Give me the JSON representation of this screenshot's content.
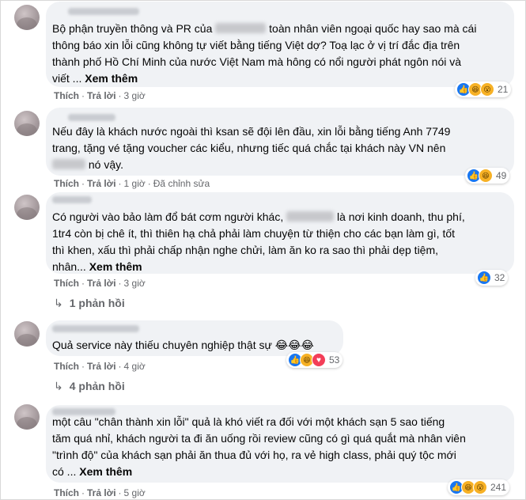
{
  "comments": [
    {
      "lines": [
        [
          "Bộ phận truyền thông và PR của ",
          " toàn nhân viên ngoại quốc hay sao mà cái"
        ],
        [
          "thông báo xin lỗi cũng không tự viết bằng tiếng Việt dợ? Toạ lạc ở vị trí đắc địa trên"
        ],
        [
          "thành phố Hồ Chí Minh của nước Việt Nam mà hông có nổi người phát ngôn nói và"
        ],
        [
          "viết ... "
        ]
      ],
      "see_more": "Xem thêm",
      "like": "Thích",
      "reply": "Trả lời",
      "time": "3 giờ",
      "reaction_count": "21"
    },
    {
      "lines": [
        [
          "Nếu đây là khách nước ngoài thì ksan sẽ đội lên đầu, xin lỗi bằng tiếng Anh 7749"
        ],
        [
          "trang, tặng vé tặng voucher các kiểu, nhưng tiếc quá chắc tại khách này VN nên"
        ],
        [
          "",
          " nó vậy."
        ]
      ],
      "like": "Thích",
      "reply": "Trả lời",
      "time": "1 giờ",
      "edited": "Đã chỉnh sửa",
      "reaction_count": "49"
    },
    {
      "lines": [
        [
          "Có người vào bảo làm đổ bát cơm người khác, ",
          " là nơi kinh doanh, thu phí,"
        ],
        [
          "1tr4 còn bị chê ít, thì thiên hạ chả phải làm chuyện từ thiện cho các bạn làm gì, tốt"
        ],
        [
          "thì khen, xấu thì phải chấp nhận nghe chửi, làm ăn ko ra sao thì phải dẹp tiệm,"
        ],
        [
          "nhân... "
        ]
      ],
      "see_more": "Xem thêm",
      "like": "Thích",
      "reply": "Trả lời",
      "time": "3 giờ",
      "reaction_count": "32",
      "replies": "1 phản hồi"
    },
    {
      "lines": [
        [
          "Quả service này thiếu chuyên nghiệp thật sự 😂😂😂"
        ]
      ],
      "like": "Thích",
      "reply": "Trả lời",
      "time": "4 giờ",
      "reaction_count": "53",
      "replies": "4 phản hồi"
    },
    {
      "lines": [
        [
          "một câu \"chân thành xin lỗi\" quả là khó viết ra đối với một khách sạn 5 sao tiếng"
        ],
        [
          "tăm quá nhỉ, khách người ta đi ăn uống rồi review cũng có gì quá quắt mà nhân viên"
        ],
        [
          "\"trình độ\" của khách sạn phải ăn thua đủ với họ, ra vẻ high class, phải quý tộc mới"
        ],
        [
          "có ... "
        ]
      ],
      "see_more": "Xem thêm",
      "like": "Thích",
      "reply": "Trả lời",
      "time": "5 giờ",
      "reaction_count": "241"
    }
  ],
  "colors": {
    "bubble": "#f0f2f5",
    "meta": "#65676b",
    "like_blue": "#1877f2",
    "haha_yellow": "#f7b125",
    "love_red": "#f33e58"
  }
}
